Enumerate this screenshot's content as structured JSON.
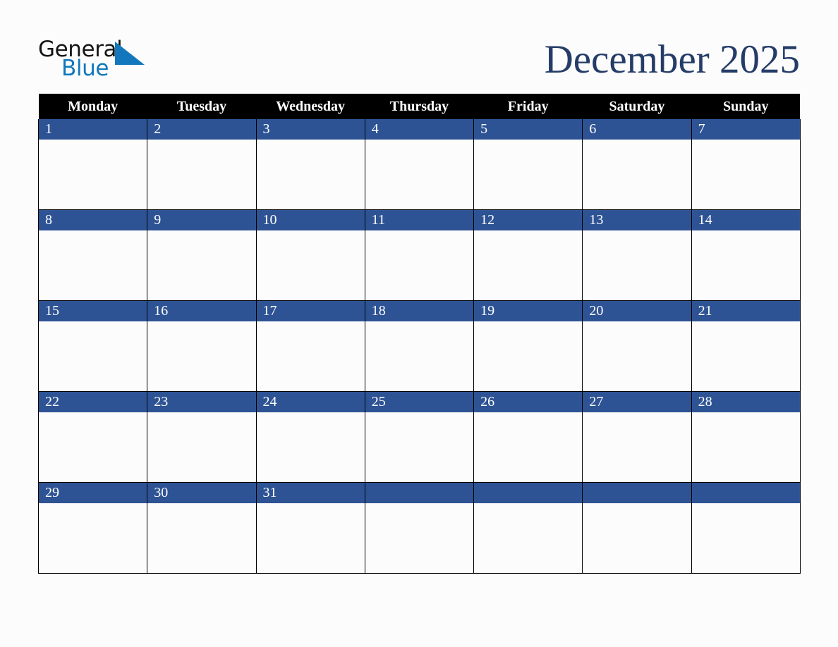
{
  "brand": {
    "name_part1": "General",
    "name_part2": "Blue",
    "triangle_color": "#1277bc",
    "part1_color": "#151515",
    "part2_color": "#1277bc"
  },
  "header": {
    "title": "December 2025",
    "title_color": "#253c68"
  },
  "calendar": {
    "month": "December",
    "year": "2025",
    "first_day_of_week": "Monday",
    "header_bg": "#000000",
    "header_text_color": "#ffffff",
    "date_band_color": "#2e5394",
    "date_text_color": "#ffffff",
    "cell_bg": "#fcfcfc",
    "grid_line_color": "#000000",
    "weekdays": [
      "Monday",
      "Tuesday",
      "Wednesday",
      "Thursday",
      "Friday",
      "Saturday",
      "Sunday"
    ],
    "weeks": [
      [
        "1",
        "2",
        "3",
        "4",
        "5",
        "6",
        "7"
      ],
      [
        "8",
        "9",
        "10",
        "11",
        "12",
        "13",
        "14"
      ],
      [
        "15",
        "16",
        "17",
        "18",
        "19",
        "20",
        "21"
      ],
      [
        "22",
        "23",
        "24",
        "25",
        "26",
        "27",
        "28"
      ],
      [
        "29",
        "30",
        "31",
        "",
        "",
        "",
        ""
      ]
    ]
  },
  "page": {
    "background_color": "#fcfcfc"
  }
}
